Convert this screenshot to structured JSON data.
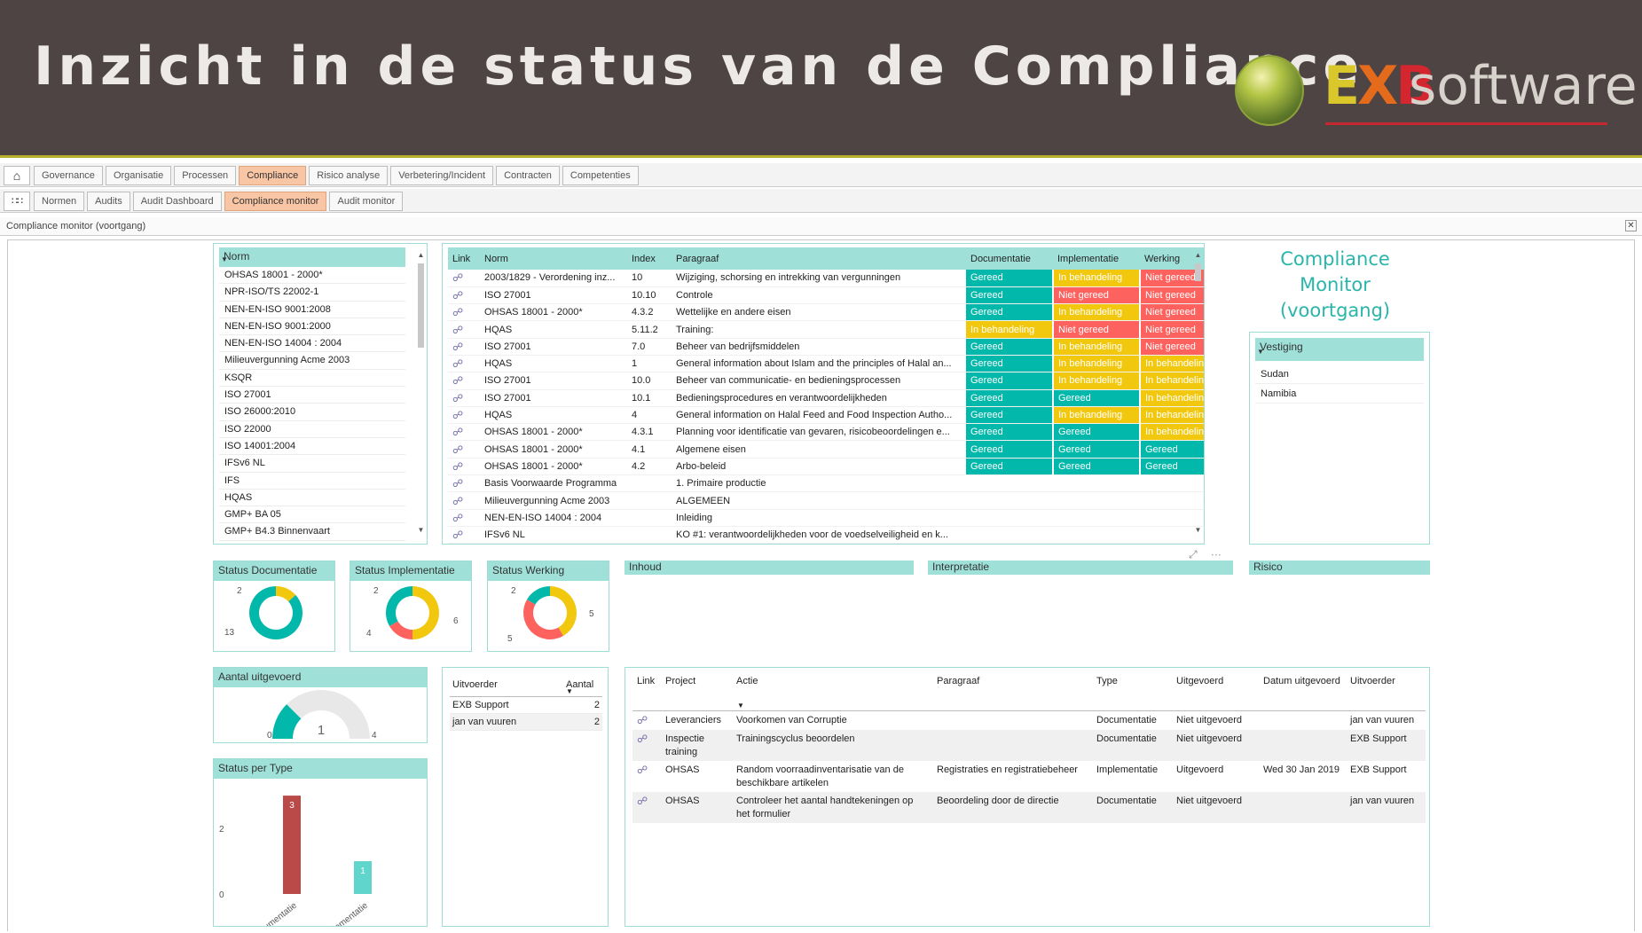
{
  "banner": {
    "title": "Inzicht in de status van de Compliance",
    "logo": {
      "exb": [
        "E",
        "X",
        "B"
      ],
      "software": "software"
    }
  },
  "nav1": {
    "home_icon": "home-icon",
    "tabs": [
      "Governance",
      "Organisatie",
      "Processen",
      "Compliance",
      "Risico analyse",
      "Verbetering/Incident",
      "Contracten",
      "Competenties"
    ],
    "active": 3
  },
  "nav2": {
    "apps_icon": "apps-grid-icon",
    "tabs": [
      "Normen",
      "Audits",
      "Audit Dashboard",
      "Compliance monitor",
      "Audit monitor"
    ],
    "active": 3
  },
  "window": {
    "title": "Compliance monitor (voortgang)",
    "close": "✕"
  },
  "norm_list": {
    "header": "Norm",
    "items": [
      "OHSAS 18001 - 2000*",
      "NPR-ISO/TS 22002-1",
      "NEN-EN-ISO 9001:2008",
      "NEN-EN-ISO 9001:2000",
      "NEN-EN-ISO 14004 : 2004",
      "Milieuvergunning Acme 2003",
      "KSQR",
      "ISO 27001",
      "ISO 26000:2010",
      "ISO 22000",
      "ISO 14001:2004",
      "IFSv6 NL",
      "IFS",
      "HQAS",
      "GMP+ BA 05",
      "GMP+ B4.3 Binnenvaart"
    ]
  },
  "main_table": {
    "columns": [
      "Link",
      "Norm",
      "Index",
      "Paragraaf",
      "Documentatie",
      "Implementatie",
      "Werking"
    ],
    "rows": [
      [
        "2003/1829 - Verordening inz...",
        "10",
        "Wijziging, schorsing en intrekking van vergunningen",
        "Gereed",
        "In behandeling",
        "Niet gereed"
      ],
      [
        "ISO 27001",
        "10.10",
        "Controle",
        "Gereed",
        "Niet gereed",
        "Niet gereed"
      ],
      [
        "OHSAS 18001 - 2000*",
        "4.3.2",
        "Wettelijke en andere eisen",
        "Gereed",
        "In behandeling",
        "Niet gereed"
      ],
      [
        "HQAS",
        "5.11.2",
        "Training:",
        "In behandeling",
        "Niet gereed",
        "Niet gereed"
      ],
      [
        "ISO 27001",
        "7.0",
        "Beheer van bedrijfsmiddelen",
        "Gereed",
        "In behandeling",
        "Niet gereed"
      ],
      [
        "HQAS",
        "1",
        "General information about Islam and the principles of Halal an...",
        "Gereed",
        "In behandeling",
        "In behandeling"
      ],
      [
        "ISO 27001",
        "10.0",
        "Beheer van communicatie- en bedieningsprocessen",
        "Gereed",
        "In behandeling",
        "In behandeling"
      ],
      [
        "ISO 27001",
        "10.1",
        "Bedieningsprocedures en verantwoordelijkheden",
        "Gereed",
        "Gereed",
        "In behandeling"
      ],
      [
        "HQAS",
        "4",
        "General information on Halal Feed and Food Inspection Autho...",
        "Gereed",
        "In behandeling",
        "In behandeling"
      ],
      [
        "OHSAS 18001 - 2000*",
        "4.3.1",
        "Planning voor identificatie van gevaren, risicobeoordelingen e...",
        "Gereed",
        "Gereed",
        "In behandeling"
      ],
      [
        "OHSAS 18001 - 2000*",
        "4.1",
        "Algemene eisen",
        "Gereed",
        "Gereed",
        "Gereed"
      ],
      [
        "OHSAS 18001 - 2000*",
        "4.2",
        "Arbo-beleid",
        "Gereed",
        "Gereed",
        "Gereed"
      ],
      [
        "Basis Voorwaarde Programma",
        "",
        "1. Primaire productie",
        "",
        "",
        ""
      ],
      [
        "Milieuvergunning Acme 2003",
        "",
        "ALGEMEEN",
        "",
        "",
        ""
      ],
      [
        "NEN-EN-ISO 14004 : 2004",
        "",
        "Inleiding",
        "",
        "",
        ""
      ],
      [
        "IFSv6 NL",
        "",
        "KO #1: verantwoordelijkheden voor de voedselveiligheid en k...",
        "",
        "",
        ""
      ]
    ]
  },
  "cm_title": [
    "Compliance",
    "Monitor",
    "(voortgang)"
  ],
  "vestiging": {
    "header": "Vestiging",
    "items": [
      "Sudan",
      "Namibia"
    ]
  },
  "donuts": [
    {
      "title": "Status Documentatie",
      "labels": [
        "2",
        "13"
      ],
      "slices": [
        {
          "value": 2,
          "color": "#f2c80f"
        },
        {
          "value": 13,
          "color": "#01b8aa"
        }
      ]
    },
    {
      "title": "Status Implementatie",
      "labels": [
        "2",
        "4",
        "6"
      ],
      "slices": [
        {
          "value": 6,
          "color": "#f2c80f"
        },
        {
          "value": 2,
          "color": "#fd625e"
        },
        {
          "value": 4,
          "color": "#01b8aa"
        }
      ]
    },
    {
      "title": "Status Werking",
      "labels": [
        "2",
        "5",
        "5"
      ],
      "slices": [
        {
          "value": 5,
          "color": "#f2c80f"
        },
        {
          "value": 5,
          "color": "#fd625e"
        },
        {
          "value": 2,
          "color": "#01b8aa"
        }
      ]
    }
  ],
  "section_headers": {
    "inhoud": "Inhoud",
    "interpretatie": "Interpretatie",
    "risico": "Risico"
  },
  "focus_icons": "⤢ ⋯",
  "aantal": {
    "title": "Aantal uitgevoerd",
    "value": "1",
    "min": "0",
    "max": "4",
    "fraction": 0.25
  },
  "per_type": {
    "title": "Status per Type"
  },
  "chart_data": {
    "type": "bar",
    "title": "Status per Type",
    "categories": [
      "Documentatie",
      "Implementatie"
    ],
    "values": [
      3,
      1
    ],
    "colors": [
      "#b94a48",
      "#5fd5cb"
    ],
    "yticks": [
      "0",
      "2"
    ],
    "ylim": [
      0,
      3.3
    ]
  },
  "uitvoerder": {
    "columns": [
      "Uitvoerder",
      "Aantal"
    ],
    "rows": [
      [
        "EXB Support",
        "2"
      ],
      [
        "jan van vuuren",
        "2"
      ]
    ]
  },
  "acties": {
    "columns": [
      "Link",
      "Project",
      "Actie",
      "Paragraaf",
      "Type",
      "Uitgevoerd",
      "Datum uitgevoerd",
      "Uitvoerder"
    ],
    "rows": [
      [
        "Leveranciers",
        "Voorkomen van Corruptie",
        "",
        "Documentatie",
        "Niet uitgevoerd",
        "",
        "jan van vuuren"
      ],
      [
        "Inspectie training",
        "Trainingscyclus beoordelen",
        "",
        "Documentatie",
        "Niet uitgevoerd",
        "",
        "EXB Support"
      ],
      [
        "OHSAS",
        "Random voorraadinventarisatie van de beschikbare artikelen",
        "Registraties en registratiebeheer",
        "Implementatie",
        "Uitgevoerd",
        "Wed 30 Jan 2019",
        "EXB Support"
      ],
      [
        "OHSAS",
        "Controleer het aantal handtekeningen op het formulier",
        "Beoordeling door de directie",
        "Documentatie",
        "Niet uitgevoerd",
        "",
        "jan van vuuren"
      ]
    ]
  }
}
